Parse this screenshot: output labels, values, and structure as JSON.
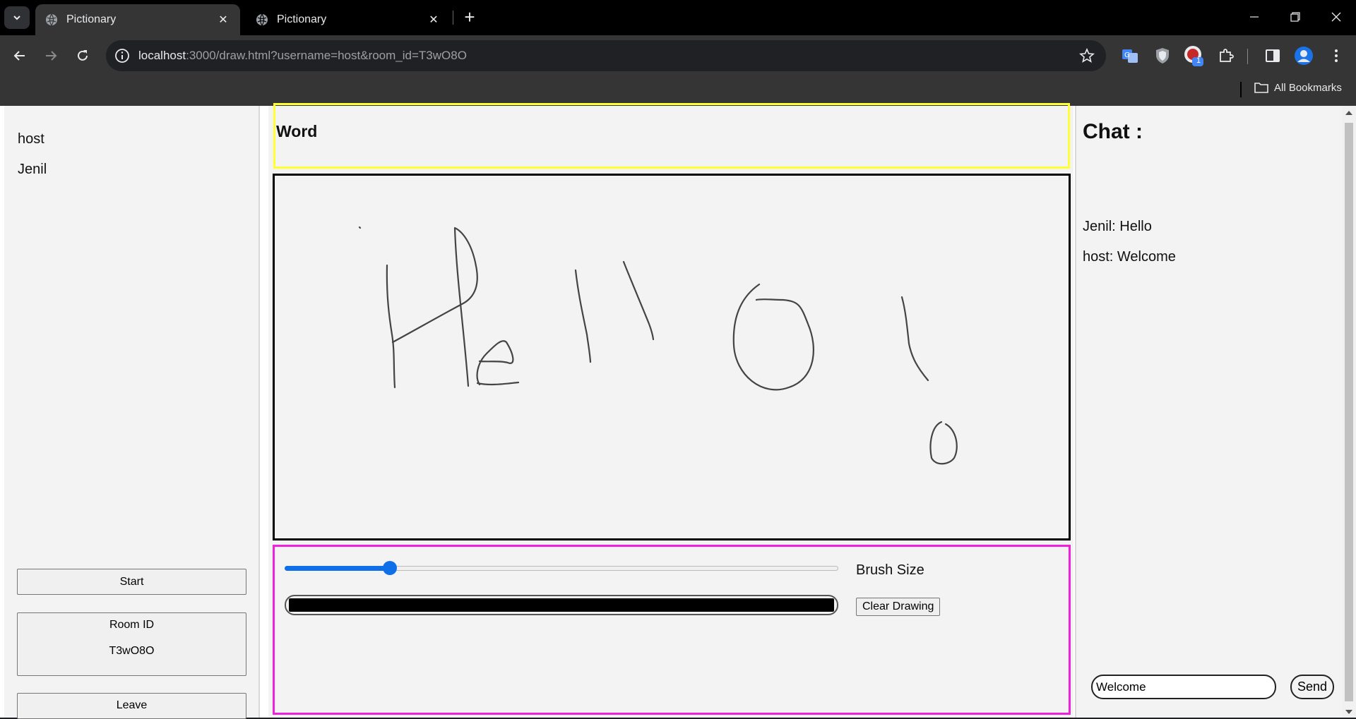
{
  "browser": {
    "tabs": [
      {
        "title": "Pictionary",
        "active": true
      },
      {
        "title": "Pictionary",
        "active": false
      }
    ],
    "url_host": "localhost",
    "url_rest": ":3000/draw.html?username=host&room_id=T3wO8O",
    "bookmarks_label": "All Bookmarks",
    "extension_badge": "1"
  },
  "left_panel": {
    "players": [
      "host",
      "Jenil"
    ],
    "start_label": "Start",
    "room_id_label": "Room ID",
    "room_id_value": "T3wO8O",
    "leave_label": "Leave"
  },
  "main": {
    "word_label": "Word",
    "brush_size_label": "Brush Size",
    "brush_size_fraction": 0.19,
    "brush_color": "#000000",
    "clear_label": "Clear Drawing"
  },
  "chat": {
    "title": "Chat :",
    "messages": [
      "Jenil: Hello",
      "host: Welcome"
    ],
    "input_value": "Welcome",
    "send_label": "Send"
  },
  "colors": {
    "word_border": "#ffff33",
    "tools_border": "#ee22dd",
    "slider_accent": "#0f6fe8"
  }
}
